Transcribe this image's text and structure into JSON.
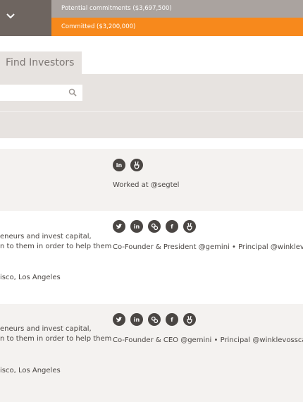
{
  "header": {
    "potential_label": "Potential commitments ($3,697,500)",
    "committed_label": "Committed ($3,200,000)"
  },
  "tabs": {
    "find_investors": "Find Investors"
  },
  "colors": {
    "accent_orange": "#f7891c",
    "dark_gray": "#6e6560",
    "light_band": "#e7e3e0",
    "row_alt": "#f4f2f0",
    "text": "#4a4643"
  },
  "investors": [
    {
      "social_icons": [
        "linkedin-icon",
        "angellist-icon"
      ],
      "worked_at": "Worked at @segtel",
      "desc_line1": "",
      "desc_line2": "",
      "location": ""
    },
    {
      "social_icons": [
        "twitter-icon",
        "linkedin-icon",
        "link-icon",
        "facebook-icon",
        "angellist-icon"
      ],
      "worked_at": "Co-Founder & President @gemini • Principal @winklevosscap",
      "desc_line1": "eneurs and invest capital,",
      "desc_line2": "n to them in order to help them",
      "location": "isco, Los Angeles"
    },
    {
      "social_icons": [
        "twitter-icon",
        "linkedin-icon",
        "link-icon",
        "facebook-icon",
        "angellist-icon"
      ],
      "worked_at": "Co-Founder & CEO @gemini • Principal @winklevosscap",
      "desc_line1": "eneurs and invest capital,",
      "desc_line2": "n to them in order to help them",
      "location": "isco, Los Angeles"
    }
  ]
}
